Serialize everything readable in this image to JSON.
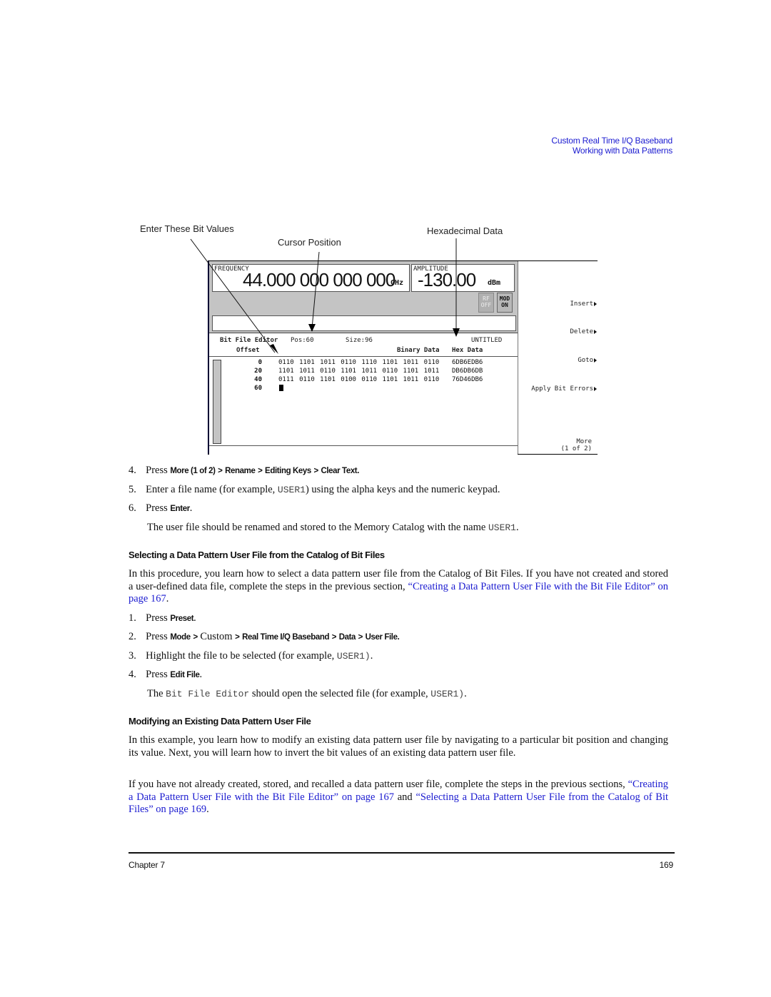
{
  "running_header": {
    "line1": "Custom Real Time I/Q Baseband",
    "line2": "Working with Data Patterns"
  },
  "figure": {
    "callouts": {
      "enter_bits": "Enter These Bit Values",
      "cursor_position": "Cursor Position",
      "hex_data": "Hexadecimal Data"
    },
    "screen": {
      "frequency_label": "FREQUENCY",
      "frequency_value": "44.000 000 000 000",
      "frequency_unit": "GHz",
      "amplitude_label": "AMPLITUDE",
      "amplitude_value": "-130.00",
      "amplitude_unit": "dBm",
      "rf_button": {
        "line1": "RF",
        "line2": "OFF"
      },
      "mod_button": {
        "line1": "MOD",
        "line2": "ON"
      },
      "editor_title": "Bit File Editor",
      "position": "Pos:60",
      "size": "Size:96",
      "file_name": "UNTITLED",
      "col_offset": "Offset",
      "col_binary": "Binary Data",
      "col_hex": "Hex Data",
      "rows": [
        {
          "offset": "0",
          "binary": "0110 1101 1011 0110 1110 1101 1011 0110",
          "hex": "6DB6EDB6"
        },
        {
          "offset": "20",
          "binary": "1101 1011 0110 1101 1011 0110 1101 1011",
          "hex": "DB6DB6DB"
        },
        {
          "offset": "40",
          "binary": "0111 0110 1101 0100 0110 1101 1011 0110",
          "hex": "76D46DB6"
        },
        {
          "offset": "60",
          "binary": "",
          "hex": ""
        }
      ],
      "softkeys": [
        {
          "label": "Insert",
          "submenu": true
        },
        {
          "label": "Delete",
          "submenu": true
        },
        {
          "label": "Goto",
          "submenu": true
        },
        {
          "label": "Apply Bit Errors",
          "submenu": true
        }
      ],
      "more_key": {
        "line1": "More",
        "line2": "(1 of 2)"
      }
    }
  },
  "steps_a": [
    {
      "num": "4.",
      "prefix": "Press",
      "keys": [
        "More (1 of 2)",
        "Rename",
        "Editing Keys",
        "Clear Text."
      ]
    },
    {
      "num": "5.",
      "text_before": "Enter a file name (for example,",
      "code": "USER1",
      "text_after": ") using the alpha keys and the numeric keypad."
    },
    {
      "num": "6.",
      "prefix": "Press",
      "key": "Enter",
      "suffix": "."
    }
  ],
  "note_a": {
    "text": "The user file should be renamed and stored to the Memory Catalog with the name",
    "code": "USER1",
    "end": "."
  },
  "section_select": {
    "heading": "Selecting a Data Pattern User File from the Catalog of Bit Files",
    "intro": "In this procedure, you learn how to select a data pattern user file from the Catalog of Bit Files. If you have not created and stored a user-defined data file, complete the steps in the previous section,",
    "intro_link": "“Creating a Data Pattern User File with the Bit File Editor” on page 167",
    "intro_end": ".",
    "steps": [
      {
        "num": "1.",
        "prefix": "Press",
        "key": "Preset",
        "suffix": "."
      },
      {
        "num": "2.",
        "prefix": "Press",
        "key1": "Mode",
        "plain": "Custom",
        "key2": "Real Time I/Q Baseband",
        "key3": "Data",
        "key4": "User File."
      },
      {
        "num": "3.",
        "text_before": "Highlight the file to be selected (for example,",
        "code": "USER1)",
        "text_after": "."
      },
      {
        "num": "4.",
        "prefix": "Press",
        "key": "Edit File",
        "suffix": "."
      }
    ],
    "note": {
      "pre": "The",
      "code1": "Bit File Editor",
      "mid": "should open the selected file (for example,",
      "code2": "USER1)",
      "end": "."
    }
  },
  "section_modify": {
    "heading": "Modifying an Existing Data Pattern User File",
    "para1": "In this example, you learn how to modify an existing data pattern user file by navigating to a particular bit position and changing its value. Next, you will learn how to invert the bit values of an existing data pattern user file.",
    "para2_start": "If you have not already created, stored, and recalled a data pattern user file, complete the steps in the previous sections,",
    "para2_link1": "“Creating a Data Pattern User File with the Bit File Editor” on page 167",
    "para2_and": "and",
    "para2_link2": "“Selecting a Data Pattern User File from the Catalog of Bit Files” on page 169",
    "para2_end": "."
  },
  "footer": {
    "chapter": "Chapter 7",
    "page": "169"
  },
  "colors": {
    "link": "#1a1ad0",
    "screen_gray": "#c4c4c4"
  }
}
